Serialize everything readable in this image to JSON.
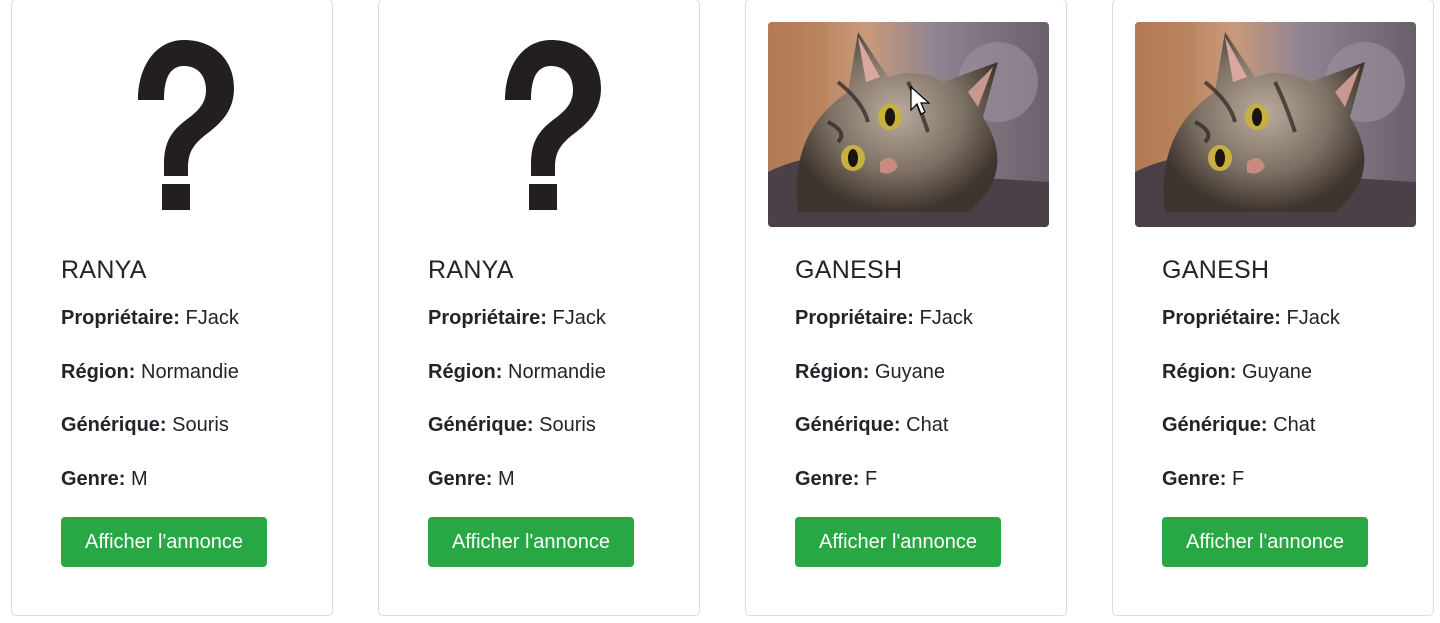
{
  "cards": [
    {
      "image": "question-mark",
      "name": "RANYA",
      "owner_label": "Propriétaire:",
      "owner": "FJack",
      "region_label": "Région:",
      "region": "Normandie",
      "generic_label": "Générique:",
      "generic": "Souris",
      "gender_label": "Genre:",
      "gender": "M",
      "button_label": "Afficher l'annonce"
    },
    {
      "image": "question-mark",
      "name": "RANYA",
      "owner_label": "Propriétaire:",
      "owner": "FJack",
      "region_label": "Région:",
      "region": "Normandie",
      "generic_label": "Générique:",
      "generic": "Souris",
      "gender_label": "Genre:",
      "gender": "M",
      "button_label": "Afficher l'annonce"
    },
    {
      "image": "cat-photo",
      "name": "GANESH",
      "owner_label": "Propriétaire:",
      "owner": "FJack",
      "region_label": "Région:",
      "region": "Guyane",
      "generic_label": "Générique:",
      "generic": "Chat",
      "gender_label": "Genre:",
      "gender": "F",
      "button_label": "Afficher l'annonce"
    },
    {
      "image": "cat-photo",
      "name": "GANESH",
      "owner_label": "Propriétaire:",
      "owner": "FJack",
      "region_label": "Région:",
      "region": "Guyane",
      "generic_label": "Générique:",
      "generic": "Chat",
      "gender_label": "Genre:",
      "gender": "F",
      "button_label": "Afficher l'annonce"
    }
  ],
  "colors": {
    "button": "#28a745",
    "button_text": "#ffffff",
    "border": "#dcdcdc",
    "text": "#212529"
  }
}
